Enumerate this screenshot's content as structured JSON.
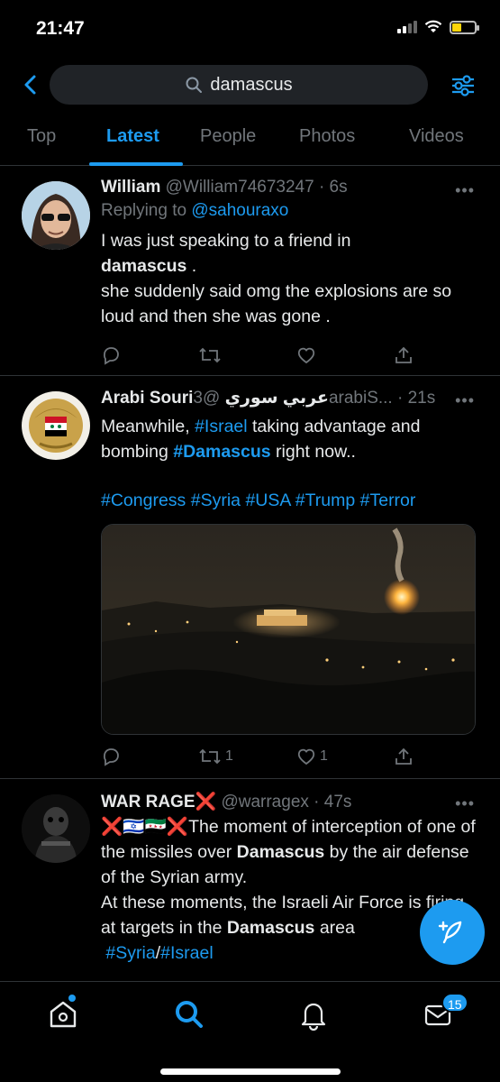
{
  "status_bar": {
    "time": "21:47"
  },
  "search": {
    "query": "damascus"
  },
  "tabs": [
    {
      "label": "Top"
    },
    {
      "label": "Latest"
    },
    {
      "label": "People"
    },
    {
      "label": "Photos"
    },
    {
      "label": "Videos"
    }
  ],
  "tweets": [
    {
      "name": "William",
      "handle": "@William74673247",
      "time": "· 6s",
      "replying_label": "Replying to",
      "replying_to": "@sahouraxo",
      "text_1": "I was just speaking to a friend in",
      "text_2": "damascus",
      "text_3": " .",
      "text_4": " she suddenly said omg the explosions are so loud and then she was gone .",
      "reply_count": "",
      "retweet_count": "",
      "like_count": ""
    },
    {
      "name": "Arabi Souri",
      "name_arabic": "عربي سوري",
      "handle": "@3arabiS...",
      "time": "· 21s",
      "text_1": "Meanwhile, ",
      "hashtag_israel": "#Israel",
      "text_2": " taking advantage and bombing ",
      "hashtag_damascus": "#Damascus",
      "text_3": " right now..",
      "hashtags_line": [
        "#Congress",
        "#Syria",
        "#USA",
        "#Trump",
        "#Terror"
      ],
      "retweet_count": "1",
      "like_count": "1"
    },
    {
      "name": "WAR RAGE",
      "name_suffix": "❌",
      "handle": "@warragex",
      "time": "· 47s",
      "emoji_prefix": "❌🇮🇱🇸🇾❌",
      "text_1": "The moment of interception of one of the missiles over ",
      "bold_1": "Damascus",
      "text_2": " by the air defense of the Syrian army.",
      "text_3": " At these moments, the Israeli Air Force is firing at targets in the ",
      "bold_2": "Damascus",
      "text_4": " area",
      "hashtag_syria": "#Syria",
      "slash": "/",
      "hashtag_israel": "#Israel"
    }
  ],
  "bottom_nav": {
    "items": [
      "home-icon",
      "search-icon",
      "notifications-icon",
      "messages-icon"
    ],
    "messages_badge": "15"
  },
  "colors": {
    "accent": "#1d9bf0",
    "background": "#000000",
    "muted": "#71767b"
  }
}
